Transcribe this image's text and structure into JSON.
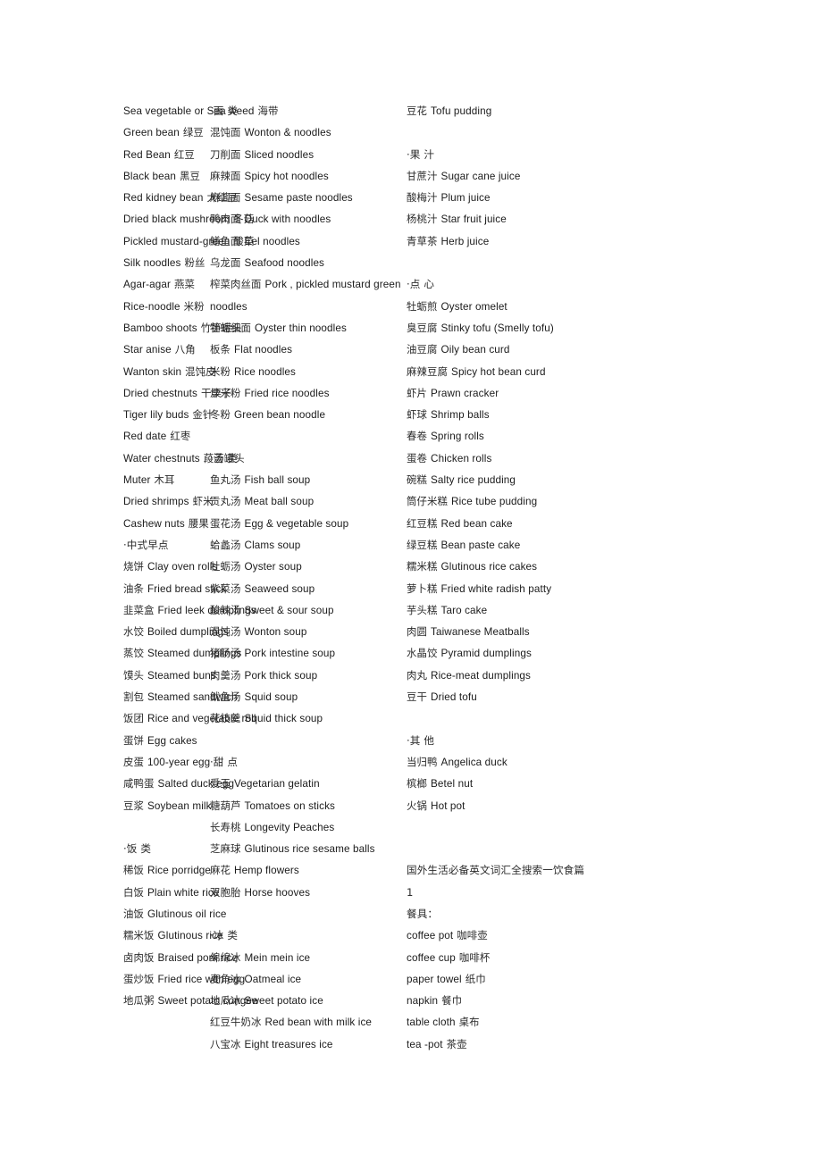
{
  "document": {
    "title": "国外生活必备英文词汇全搜索一饮食篇",
    "page_number": "1",
    "background": "#ffffff",
    "text_color": "#1b1b1b"
  },
  "columns": [
    {
      "id": "column-1",
      "entries": [
        {
          "type": "entry",
          "en": "Sea vegetable or Sea weed",
          "cn": "海带"
        },
        {
          "type": "entry",
          "en": "Green bean",
          "cn": "绿豆"
        },
        {
          "type": "entry",
          "en": "Red Bean",
          "cn": "红豆"
        },
        {
          "type": "entry",
          "en": "Black bean",
          "cn": "黑豆"
        },
        {
          "type": "entry",
          "en": "Red kidney bean",
          "cn": "大红豆"
        },
        {
          "type": "entry",
          "en": "Dried black mushroom",
          "cn": "冬菇"
        },
        {
          "type": "entry",
          "en": "Pickled mustard-green",
          "cn": "酸菜"
        },
        {
          "type": "entry",
          "en": "Silk noodles",
          "cn": "粉丝"
        },
        {
          "type": "entry",
          "en": "Agar-agar",
          "cn": "燕菜"
        },
        {
          "type": "entry",
          "en": "Rice-noodle",
          "cn": "米粉"
        },
        {
          "type": "entry",
          "en": "Bamboo shoots",
          "cn": "竹笋罐头"
        },
        {
          "type": "entry",
          "en": "Star anise",
          "cn": "八角"
        },
        {
          "type": "entry",
          "en": "Wanton skin",
          "cn": "混饨皮"
        },
        {
          "type": "entry",
          "en": "Dried chestnuts",
          "cn": "干栗子"
        },
        {
          "type": "entry",
          "en": "Tiger lily buds",
          "cn": "金针"
        },
        {
          "type": "entry",
          "en": "Red date",
          "cn": "红枣"
        },
        {
          "type": "entry",
          "en": "Water chestnuts",
          "cn": "葮荟罐头"
        },
        {
          "type": "entry",
          "en": "Muter",
          "cn": "木耳"
        },
        {
          "type": "entry",
          "en": "Dried shrimps",
          "cn": "虾米"
        },
        {
          "type": "entry",
          "en": "Cashew nuts",
          "cn": "腰果"
        },
        {
          "type": "section",
          "cn": "·中式早点",
          "en": ""
        },
        {
          "type": "entry",
          "cn": "烧饼",
          "en": "Clay oven rolls",
          "cn_first": true
        },
        {
          "type": "entry",
          "cn": "油条",
          "en": "Fried bread stick",
          "cn_first": true
        },
        {
          "type": "entry",
          "cn": "韭菜盒",
          "en": "Fried leek dumplings",
          "cn_first": true
        },
        {
          "type": "entry",
          "cn": "水饺",
          "en": "Boiled dumplings",
          "cn_first": true
        },
        {
          "type": "entry",
          "cn": "蒸饺",
          "en": "Steamed dumplings",
          "cn_first": true
        },
        {
          "type": "entry",
          "cn": "馍头",
          "en": "Steamed buns",
          "cn_first": true
        },
        {
          "type": "entry",
          "cn": "割包",
          "en": "Steamed sandwich",
          "cn_first": true
        },
        {
          "type": "entry",
          "cn": "饭团",
          "en": "Rice and vegetable roll",
          "cn_first": true
        },
        {
          "type": "entry",
          "cn": "蛋饼",
          "en": "Egg cakes",
          "cn_first": true
        },
        {
          "type": "entry",
          "cn": "皮蛋",
          "en": "100-year egg",
          "cn_first": true
        },
        {
          "type": "entry",
          "cn": "咸鸭蛋",
          "en": "Salted duck egg",
          "cn_first": true
        },
        {
          "type": "entry",
          "cn": "豆浆",
          "en": "Soybean milk",
          "cn_first": true
        },
        {
          "type": "spacer"
        },
        {
          "type": "section",
          "cn": "·饭 类",
          "en": ""
        },
        {
          "type": "entry",
          "cn": "稀饭",
          "en": "Rice porridge",
          "cn_first": true
        },
        {
          "type": "entry",
          "cn": "白饭",
          "en": "Plain white rice",
          "cn_first": true
        },
        {
          "type": "entry",
          "cn": "油饭",
          "en": "Glutinous oil rice",
          "cn_first": true
        },
        {
          "type": "entry",
          "cn": "糯米饭",
          "en": "Glutinous rice",
          "cn_first": true
        },
        {
          "type": "entry",
          "cn": "卤肉饭",
          "en": "Braised pork rice",
          "cn_first": true
        },
        {
          "type": "entry",
          "cn": "蛋炒饭",
          "en": "Fried rice with egg",
          "cn_first": true
        },
        {
          "type": "entry",
          "cn": "地瓜粥",
          "en": "Sweet potato congee",
          "cn_first": true
        }
      ]
    },
    {
      "id": "column-2",
      "entries": [
        {
          "type": "section",
          "cn": "·面 类",
          "en": ""
        },
        {
          "type": "entry",
          "cn": "混饨面",
          "en": "Wonton & noodles",
          "cn_first": true
        },
        {
          "type": "entry",
          "cn": "刀削面",
          "en": "Sliced noodles",
          "cn_first": true
        },
        {
          "type": "entry",
          "cn": "麻辣面",
          "en": "Spicy hot noodles",
          "cn_first": true
        },
        {
          "type": "entry",
          "cn": "麻酱面",
          "en": "Sesame paste noodles",
          "cn_first": true
        },
        {
          "type": "entry",
          "cn": "鸭肉面",
          "en": "Duck with noodles",
          "cn_first": true
        },
        {
          "type": "entry",
          "cn": "鱔鱼面",
          "en": "Eel noodles",
          "cn_first": true
        },
        {
          "type": "entry",
          "cn": "乌龙面",
          "en": "Seafood noodles",
          "cn_first": true
        },
        {
          "type": "entry",
          "cn": "榨菜肉丝面",
          "en": "Pork , pickled mustard green",
          "cn_first": true
        },
        {
          "type": "entry",
          "cn": "",
          "en": "noodles",
          "cn_first": false
        },
        {
          "type": "entry",
          "cn": "牡蛎细面",
          "en": "Oyster thin noodles",
          "cn_first": true
        },
        {
          "type": "entry",
          "cn": "板条",
          "en": "Flat noodles",
          "cn_first": true
        },
        {
          "type": "entry",
          "cn": "米粉",
          "en": "Rice noodles",
          "cn_first": true
        },
        {
          "type": "entry",
          "cn": "炒米粉",
          "en": "Fried rice noodles",
          "cn_first": true
        },
        {
          "type": "entry",
          "cn": "冬粉",
          "en": "Green bean noodle",
          "cn_first": true
        },
        {
          "type": "spacer"
        },
        {
          "type": "section",
          "cn": "·汤 类",
          "en": ""
        },
        {
          "type": "entry",
          "cn": "鱼丸汤",
          "en": "Fish ball soup",
          "cn_first": true
        },
        {
          "type": "entry",
          "cn": "贡丸汤",
          "en": "Meat ball soup",
          "cn_first": true
        },
        {
          "type": "entry",
          "cn": "蛋花汤",
          "en": "Egg & vegetable soup",
          "cn_first": true
        },
        {
          "type": "entry",
          "cn": "蛤蠡汤",
          "en": "Clams soup",
          "cn_first": true
        },
        {
          "type": "entry",
          "cn": "牡蛎汤",
          "en": "Oyster soup",
          "cn_first": true
        },
        {
          "type": "entry",
          "cn": "紫菜汤",
          "en": "Seaweed soup",
          "cn_first": true
        },
        {
          "type": "entry",
          "cn": "酸辣汤",
          "en": "Sweet & sour soup",
          "cn_first": true
        },
        {
          "type": "entry",
          "cn": "混饨汤",
          "en": "Wonton soup",
          "cn_first": true
        },
        {
          "type": "entry",
          "cn": "猪肠汤",
          "en": "Pork intestine soup",
          "cn_first": true
        },
        {
          "type": "entry",
          "cn": "肉羹汤",
          "en": "Pork thick soup",
          "cn_first": true
        },
        {
          "type": "entry",
          "cn": "鱿鱼汤",
          "en": "Squid soup",
          "cn_first": true
        },
        {
          "type": "entry",
          "cn": "花枝羹",
          "en": "Squid thick soup",
          "cn_first": true
        },
        {
          "type": "spacer"
        },
        {
          "type": "section",
          "cn": "·甜 点",
          "en": ""
        },
        {
          "type": "entry",
          "cn": "爱玉",
          "en": "Vegetarian gelatin",
          "cn_first": true
        },
        {
          "type": "entry",
          "cn": "糖葫芦",
          "en": "Tomatoes on sticks",
          "cn_first": true
        },
        {
          "type": "entry",
          "cn": "长寿桃",
          "en": "Longevity Peaches",
          "cn_first": true
        },
        {
          "type": "entry",
          "cn": "芝麻球",
          "en": "Glutinous rice sesame balls",
          "cn_first": true
        },
        {
          "type": "entry",
          "cn": "麻花",
          "en": "Hemp flowers",
          "cn_first": true
        },
        {
          "type": "entry",
          "cn": "双胞胎",
          "en": "Horse hooves",
          "cn_first": true
        },
        {
          "type": "spacer"
        },
        {
          "type": "section",
          "cn": "·冰 类",
          "en": ""
        },
        {
          "type": "entry",
          "cn": "绵绵冰",
          "en": "Mein mein ice",
          "cn_first": true
        },
        {
          "type": "entry",
          "cn": "麦角冰",
          "en": "Oatmeal ice",
          "cn_first": true
        },
        {
          "type": "entry",
          "cn": "地瓜冰",
          "en": "Sweet potato ice",
          "cn_first": true
        },
        {
          "type": "entry",
          "cn": "红豆牛奶冰",
          "en": "Red bean with milk ice",
          "cn_first": true
        },
        {
          "type": "entry",
          "cn": "八宝冰",
          "en": "Eight treasures ice",
          "cn_first": true
        }
      ]
    },
    {
      "id": "column-3",
      "entries": [
        {
          "type": "entry",
          "cn": "豆花",
          "en": "Tofu pudding",
          "cn_first": true
        },
        {
          "type": "spacer"
        },
        {
          "type": "section",
          "cn": "·果 汁",
          "en": ""
        },
        {
          "type": "entry",
          "cn": "甘蔗汁",
          "en": "Sugar cane juice",
          "cn_first": true
        },
        {
          "type": "entry",
          "cn": "酸梅汁",
          "en": "Plum juice",
          "cn_first": true
        },
        {
          "type": "entry",
          "cn": "杨桃汁",
          "en": "Star fruit juice",
          "cn_first": true
        },
        {
          "type": "entry",
          "cn": "青草茶",
          "en": "Herb juice",
          "cn_first": true
        },
        {
          "type": "spacer"
        },
        {
          "type": "section",
          "cn": "·点 心",
          "en": ""
        },
        {
          "type": "entry",
          "cn": "牡蛎煎",
          "en": "Oyster omelet",
          "cn_first": true
        },
        {
          "type": "entry",
          "cn": "臭豆腐",
          "en": "Stinky tofu (Smelly tofu)",
          "cn_first": true
        },
        {
          "type": "entry",
          "cn": "油豆腐",
          "en": "Oily bean curd",
          "cn_first": true
        },
        {
          "type": "entry",
          "cn": "麻辣豆腐",
          "en": "Spicy hot bean curd",
          "cn_first": true
        },
        {
          "type": "entry",
          "cn": "虾片",
          "en": "Prawn cracker",
          "cn_first": true
        },
        {
          "type": "entry",
          "cn": "虾球",
          "en": "Shrimp balls",
          "cn_first": true
        },
        {
          "type": "entry",
          "cn": "春卷",
          "en": "Spring rolls",
          "cn_first": true
        },
        {
          "type": "entry",
          "cn": "蛋卷",
          "en": "Chicken rolls",
          "cn_first": true
        },
        {
          "type": "entry",
          "cn": "碗糕",
          "en": "Salty rice pudding",
          "cn_first": true
        },
        {
          "type": "entry",
          "cn": "筒仔米糕",
          "en": "Rice tube pudding",
          "cn_first": true
        },
        {
          "type": "entry",
          "cn": "红豆糕",
          "en": "Red bean cake",
          "cn_first": true
        },
        {
          "type": "entry",
          "cn": "绿豆糕",
          "en": "Bean paste cake",
          "cn_first": true
        },
        {
          "type": "entry",
          "cn": "糯米糕",
          "en": "Glutinous rice cakes",
          "cn_first": true
        },
        {
          "type": "entry",
          "cn": "萝卜糕",
          "en": "Fried white radish patty",
          "cn_first": true
        },
        {
          "type": "entry",
          "cn": "芋头糕",
          "en": "Taro cake",
          "cn_first": true
        },
        {
          "type": "entry",
          "cn": "肉圆",
          "en": "Taiwanese Meatballs",
          "cn_first": true
        },
        {
          "type": "entry",
          "cn": "水晶饺",
          "en": "Pyramid dumplings",
          "cn_first": true
        },
        {
          "type": "entry",
          "cn": "肉丸",
          "en": "Rice-meat dumplings",
          "cn_first": true
        },
        {
          "type": "entry",
          "cn": "豆干",
          "en": "Dried tofu",
          "cn_first": true
        },
        {
          "type": "spacer"
        },
        {
          "type": "section",
          "cn": "·其 他",
          "en": ""
        },
        {
          "type": "entry",
          "cn": "当归鸭",
          "en": "Angelica duck",
          "cn_first": true
        },
        {
          "type": "entry",
          "cn": "槟榔",
          "en": "Betel nut",
          "cn_first": true
        },
        {
          "type": "entry",
          "cn": "火锅",
          "en": "Hot pot",
          "cn_first": true
        },
        {
          "type": "spacer"
        },
        {
          "type": "spacer"
        },
        {
          "type": "title",
          "cn": "国外生活必备英文词汇全搜索一饮食篇",
          "en": ""
        },
        {
          "type": "pagenum",
          "cn": "1",
          "en": ""
        },
        {
          "type": "section",
          "cn": "餐具：",
          "en": ""
        },
        {
          "type": "entry",
          "en": "coffee pot",
          "cn": "咖啡壶"
        },
        {
          "type": "entry",
          "en": "coffee cup",
          "cn": "咖啡杯"
        },
        {
          "type": "entry",
          "en": "paper towel",
          "cn": "纸巾"
        },
        {
          "type": "entry",
          "en": "napkin",
          "cn": "餐巾"
        },
        {
          "type": "entry",
          "en": "table cloth",
          "cn": "桌布"
        },
        {
          "type": "entry",
          "en": "tea -pot",
          "cn": "茶壶"
        }
      ]
    }
  ]
}
